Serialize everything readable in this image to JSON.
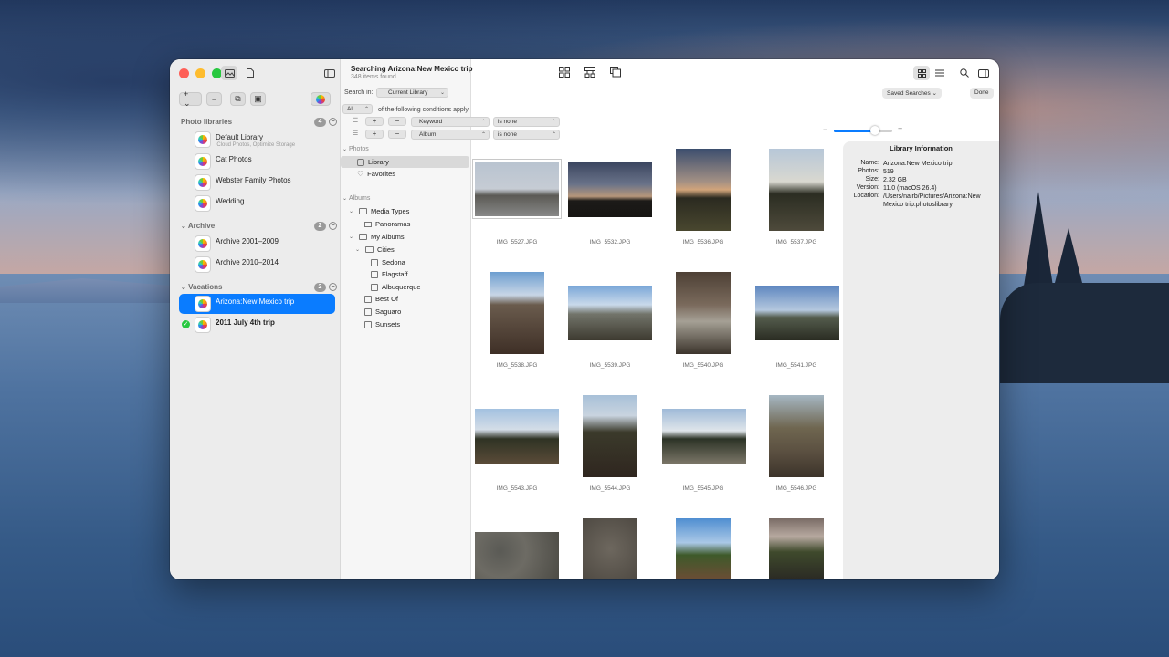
{
  "window": {
    "search_title": "Searching Arizona:New Mexico trip",
    "search_count": "348 items found"
  },
  "sidebar": {
    "sections": [
      {
        "label": "Photo libraries",
        "count": "4"
      },
      {
        "label": "Archive",
        "count": "2"
      },
      {
        "label": "Vacations",
        "count": "2"
      }
    ],
    "libraries": [
      {
        "name": "Default Library",
        "sub": "iCloud Photos, Optimize Storage"
      },
      {
        "name": "Cat Photos"
      },
      {
        "name": "Webster Family Photos"
      },
      {
        "name": "Wedding"
      },
      {
        "name": "Archive 2001–2009"
      },
      {
        "name": "Archive 2010–2014"
      },
      {
        "name": "Arizona:New Mexico trip"
      },
      {
        "name": "2011 July 4th trip"
      }
    ]
  },
  "search": {
    "search_in_label": "Search in:",
    "search_in_value": "Current Library",
    "match_value": "All",
    "match_suffix": "of the following conditions apply",
    "conditions": [
      {
        "field": "Keyword",
        "op": "is none"
      },
      {
        "field": "Album",
        "op": "is none"
      }
    ]
  },
  "tree": {
    "photos_head": "Photos",
    "library": "Library",
    "favorites": "Favorites",
    "albums_head": "Albums",
    "media_types": "Media Types",
    "panoramas": "Panoramas",
    "my_albums": "My Albums",
    "cities": "Cities",
    "sedona": "Sedona",
    "flagstaff": "Flagstaff",
    "albuquerque": "Albuquerque",
    "best_of": "Best Of",
    "saguaro": "Saguaro",
    "sunsets": "Sunsets"
  },
  "toolbar": {
    "saved_searches": "Saved Searches",
    "done": "Done",
    "zoom_level": 0.7
  },
  "grid": {
    "captions": [
      "IMG_5527.JPG",
      "IMG_5532.JPG",
      "IMG_5536.JPG",
      "IMG_5537.JPG",
      "IMG_5538.JPG",
      "IMG_5539.JPG",
      "IMG_5540.JPG",
      "IMG_5541.JPG",
      "IMG_5543.JPG",
      "IMG_5544.JPG",
      "IMG_5545.JPG",
      "IMG_5546.JPG"
    ]
  },
  "info": {
    "title": "Library Information",
    "rows": [
      {
        "k": "Name:",
        "v": "Arizona:New Mexico trip"
      },
      {
        "k": "Photos:",
        "v": "519"
      },
      {
        "k": "Size:",
        "v": "2.32 GB"
      },
      {
        "k": "Version:",
        "v": "11.0 (macOS 26.4)"
      },
      {
        "k": "Location:",
        "v": "/Users/nairb/Pictures/Arizona:New Mexico trip.photoslibrary"
      }
    ]
  },
  "colors": {
    "accent": "#0a7cff",
    "sidebar": "#ececec"
  }
}
